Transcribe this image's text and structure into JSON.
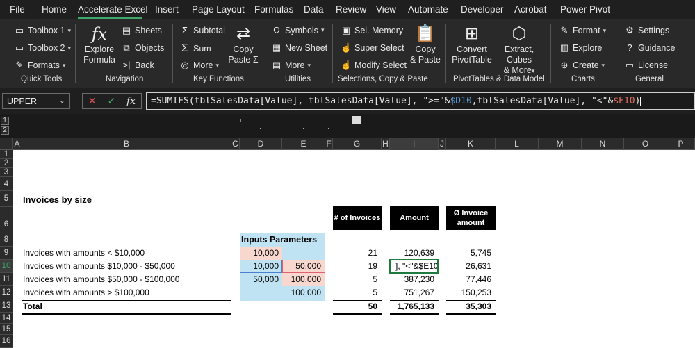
{
  "menu": {
    "items": [
      "File",
      "Home",
      "Accelerate Excel",
      "Insert",
      "Page Layout",
      "Formulas",
      "Data",
      "Review",
      "View",
      "Automate",
      "Developer",
      "Acrobat",
      "Power Pivot"
    ],
    "active": "Accelerate Excel"
  },
  "ribbon": {
    "quick_tools": {
      "toolbox1": "Toolbox 1",
      "toolbox2": "Toolbox 2",
      "formats": "Formats",
      "label": "Quick Tools"
    },
    "navigation": {
      "explore": "Explore",
      "formula": "Formula",
      "sheets": "Sheets",
      "objects": "Objects",
      "back": "Back",
      "label": "Navigation"
    },
    "key_functions": {
      "subtotal": "Subtotal",
      "sum": "Sum",
      "more": "More",
      "copy": "Copy",
      "paste_sigma": "Paste Σ",
      "label": "Key Functions"
    },
    "utilities": {
      "symbols": "Symbols",
      "new_sheet": "New Sheet",
      "more": "More",
      "label": "Utilities"
    },
    "selections": {
      "sel_memory": "Sel. Memory",
      "super_select": "Super Select",
      "modify_select": "Modify Select",
      "copy": "Copy",
      "paste": "& Paste",
      "label": "Selections, Copy & Paste"
    },
    "pivot": {
      "convert": "Convert",
      "pivottable": "PivotTable",
      "extract": "Extract, Cubes",
      "more": "& More",
      "label": "PivotTables & Data Model"
    },
    "charts": {
      "format": "Format",
      "explore": "Explore",
      "create": "Create",
      "label": "Charts"
    },
    "general": {
      "settings": "Settings",
      "guidance": "Guidance",
      "license": "License",
      "label": "General"
    }
  },
  "formula_bar": {
    "name_box": "UPPER",
    "formula_parts": [
      {
        "t": "=SUMIFS(tblSalesData[Value], tblSalesData[Value], \">=\"&",
        "c": ""
      },
      {
        "t": "$D10",
        "c": "blue"
      },
      {
        "t": ",tblSalesData[Value], \"<\"&",
        "c": ""
      },
      {
        "t": "$E10",
        "c": "red"
      },
      {
        "t": ")",
        "c": ""
      }
    ]
  },
  "outline_levels": [
    "1",
    "2"
  ],
  "columns": [
    "A",
    "B",
    "C",
    "D",
    "E",
    "F",
    "G",
    "H",
    "I",
    "J",
    "K",
    "L",
    "M",
    "N",
    "O",
    "P"
  ],
  "rows": [
    "1",
    "2",
    "3",
    "4",
    "5",
    "6",
    "8",
    "9",
    "10",
    "11",
    "12",
    "13",
    "14",
    "15",
    "16"
  ],
  "sheet": {
    "title": "Invoices by size",
    "inputs_header": "Inputs Parameters",
    "col_headers": {
      "count": "# of Invoices",
      "amount": "Amount",
      "avg": "Ø Invoice amount"
    },
    "rows": [
      {
        "label": "Invoices with amounts < $10,000",
        "d": "10,000",
        "e": "",
        "count": "21",
        "amount": "120,639",
        "avg": "5,745"
      },
      {
        "label": "Invoices with amounts $10,000 - $50,000",
        "d": "10,000",
        "e": "50,000",
        "count": "19",
        "amount": "=], \"<\"&$E10)",
        "avg": "26,631"
      },
      {
        "label": "Invoices with amounts $50,000 - $100,000",
        "d": "50,000",
        "e": "100,000",
        "count": "5",
        "amount": "387,230",
        "avg": "77,446"
      },
      {
        "label": "Invoices with amounts > $100,000",
        "d": "",
        "e": "100,000",
        "count": "5",
        "amount": "751,267",
        "avg": "150,253"
      }
    ],
    "total": {
      "label": "Total",
      "count": "50",
      "amount": "1,765,133",
      "avg": "35,303"
    }
  },
  "colors": {
    "accent": "#3ea76a",
    "input_blue": "#bfe3f2",
    "input_pink": "#f8d7cf",
    "edit_border": "#1f7a3e"
  }
}
